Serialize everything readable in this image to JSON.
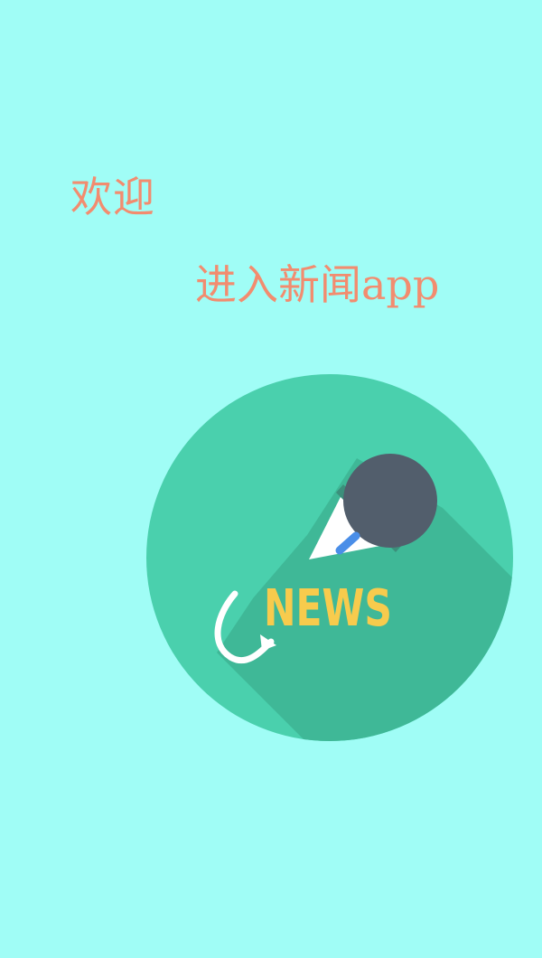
{
  "splash": {
    "welcome_text": "欢迎",
    "enter_text": "进入新闻app"
  },
  "logo": {
    "icon": "microphone-news-icon",
    "label": "NEWS"
  },
  "colors": {
    "background": "#a0fdf6",
    "text": "#f28c6f",
    "circle": "#4ad0ad",
    "circle_shadow": "#3fb897",
    "mic_head": "#525e6c",
    "mic_body": "#ffffff",
    "mic_light": "#4a8ee8",
    "news_text": "#f7cb4d"
  }
}
